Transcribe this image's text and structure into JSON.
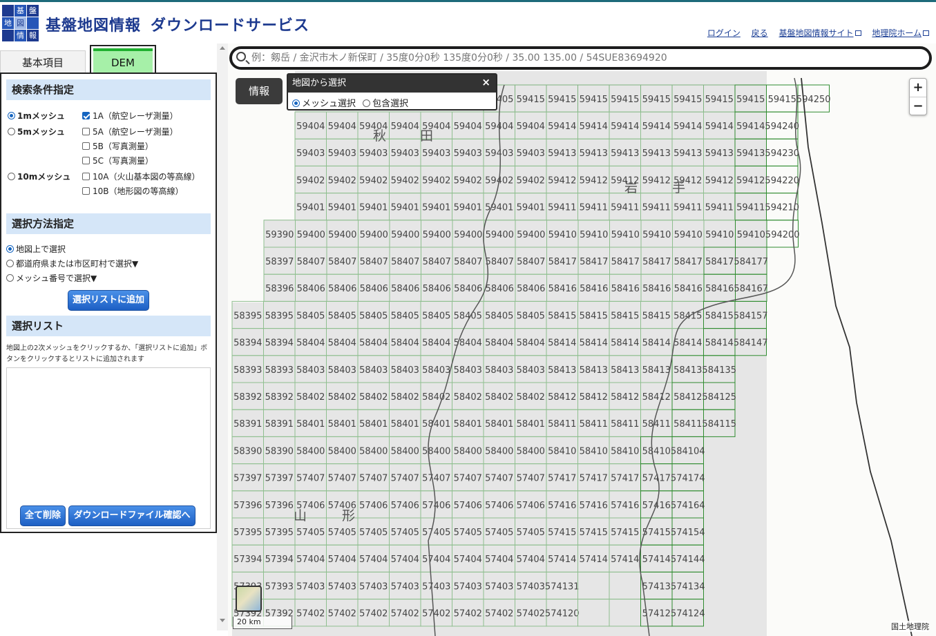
{
  "header": {
    "logo_chars": [
      "基",
      "盤",
      "地",
      "図",
      "情",
      "報"
    ],
    "title": "基盤地図情報",
    "subtitle": "ダウンロードサービス",
    "links": [
      "ログイン",
      "戻る",
      "基盤地図情報サイト",
      "地理院ホーム"
    ]
  },
  "tabs": {
    "basic": "基本項目",
    "dem": "DEM"
  },
  "search_conditions": {
    "heading": "検索条件指定",
    "mesh_1m": "1mメッシュ",
    "mesh_5m": "5mメッシュ",
    "mesh_10m": "10mメッシュ",
    "opt_1a": "1A（航空レーザ測量）",
    "opt_5a": "5A（航空レーザ測量）",
    "opt_5b": "5B（写真測量）",
    "opt_5c": "5C（写真測量）",
    "opt_10a": "10A（火山基本図の等高線）",
    "opt_10b": "10B（地形図の等高線）"
  },
  "selection_method": {
    "heading": "選択方法指定",
    "on_map": "地図上で選択",
    "by_pref": "都道府県または市区町村で選択▼",
    "by_mesh": "メッシュ番号で選択▼",
    "add_button": "選択リストに追加"
  },
  "selection_list": {
    "heading": "選択リスト",
    "hint": "地図上の2次メッシュをクリックするか、「選択リストに追加」ボタンをクリックするとリストに追加されます",
    "delete_all": "全て削除",
    "confirm": "ダウンロードファイル確認へ"
  },
  "map": {
    "search_placeholder": "例：剱岳 / 金沢市木ノ新保町 / 35度0分0秒 135度0分0秒 / 35.00 135.00 / 54SUE83694920",
    "info_button": "情報",
    "popup_title": "地図から選択",
    "popup_close": "×",
    "mesh_select": "メッシュ選択",
    "contain_select": "包含選択",
    "zoom_in": "+",
    "zoom_out": "−",
    "scale": "20 km",
    "attribution": "国土地理院",
    "place_labels": [
      "秋",
      "田",
      "岩",
      "手",
      "山",
      "形"
    ],
    "rows": [
      [
        "59404",
        "59404",
        "59404",
        "59404",
        "59404",
        "59404",
        "59404",
        "59404",
        "59414",
        "59414",
        "59414",
        "59414",
        "59414",
        "59414",
        "59414",
        "594240"
      ],
      [
        "59403",
        "59403",
        "59403",
        "59403",
        "59403",
        "59403",
        "59403",
        "59403",
        "59413",
        "59413",
        "59413",
        "59413",
        "59413",
        "59413",
        "59413",
        "594230"
      ],
      [
        "59402",
        "59402",
        "59402",
        "59402",
        "59402",
        "59402",
        "59402",
        "59402",
        "59412",
        "59412",
        "59412",
        "59412",
        "59412",
        "59412",
        "59412",
        "594220"
      ],
      [
        "59401",
        "59401",
        "59401",
        "59401",
        "59401",
        "59401",
        "59401",
        "59401",
        "59411",
        "59411",
        "59411",
        "59411",
        "59411",
        "59411",
        "59411",
        "594210"
      ],
      [
        "59390",
        "59400",
        "59400",
        "59400",
        "59400",
        "59400",
        "59400",
        "59400",
        "59400",
        "59410",
        "59410",
        "59410",
        "59410",
        "59410",
        "59410",
        "59410",
        "594200"
      ],
      [
        "58397",
        "58407",
        "58407",
        "58407",
        "58407",
        "58407",
        "58407",
        "58407",
        "58407",
        "58417",
        "58417",
        "58417",
        "58417",
        "58417",
        "58417",
        "584177"
      ],
      [
        "58396",
        "58406",
        "58406",
        "58406",
        "58406",
        "58406",
        "58406",
        "58406",
        "58406",
        "58416",
        "58416",
        "58416",
        "58416",
        "58416",
        "58416",
        "584167"
      ],
      [
        "58395",
        "58395",
        "58405",
        "58405",
        "58405",
        "58405",
        "58405",
        "58405",
        "58405",
        "58405",
        "58415",
        "58415",
        "58415",
        "58415",
        "58415",
        "58415",
        "584157"
      ],
      [
        "58394",
        "58394",
        "58404",
        "58404",
        "58404",
        "58404",
        "58404",
        "58404",
        "58404",
        "58404",
        "58414",
        "58414",
        "58414",
        "58414",
        "58414",
        "58414",
        "584147"
      ],
      [
        "58393",
        "58393",
        "58403",
        "58403",
        "58403",
        "58403",
        "58403",
        "58403",
        "58403",
        "58403",
        "58413",
        "58413",
        "58413",
        "58413",
        "58413",
        "584135"
      ],
      [
        "58392",
        "58392",
        "58402",
        "58402",
        "58402",
        "58402",
        "58402",
        "58402",
        "58402",
        "58402",
        "58412",
        "58412",
        "58412",
        "58412",
        "58412",
        "584125"
      ],
      [
        "58391",
        "58391",
        "58401",
        "58401",
        "58401",
        "58401",
        "58401",
        "58401",
        "58401",
        "58401",
        "58411",
        "58411",
        "58411",
        "58411",
        "58411",
        "584115"
      ],
      [
        "58390",
        "58390",
        "58400",
        "58400",
        "58400",
        "58400",
        "58400",
        "58400",
        "58400",
        "58400",
        "58410",
        "58410",
        "58410",
        "58410",
        "584104"
      ],
      [
        "57397",
        "57397",
        "57407",
        "57407",
        "57407",
        "57407",
        "57407",
        "57407",
        "57407",
        "57407",
        "57417",
        "57417",
        "57417",
        "57417",
        "574174"
      ],
      [
        "57396",
        "57396",
        "57406",
        "57406",
        "57406",
        "57406",
        "57406",
        "57406",
        "57406",
        "57406",
        "57416",
        "57416",
        "57416",
        "57416",
        "574164"
      ],
      [
        "57395",
        "57395",
        "57405",
        "57405",
        "57405",
        "57405",
        "57405",
        "57405",
        "57405",
        "57405",
        "57415",
        "57415",
        "57415",
        "57415",
        "574154"
      ],
      [
        "57394",
        "57394",
        "57404",
        "57404",
        "57404",
        "57404",
        "57404",
        "57404",
        "57404",
        "57404",
        "57414",
        "57414",
        "57414",
        "57414",
        "574144"
      ],
      [
        "57393",
        "57393",
        "57403",
        "57403",
        "57403",
        "57403",
        "57403",
        "57403",
        "57403",
        "57403",
        "574131",
        "",
        "",
        "57413",
        "574134"
      ],
      [
        "57392",
        "57392",
        "57402",
        "57402",
        "57402",
        "57402",
        "57402",
        "57402",
        "57402",
        "57402",
        "574120",
        "",
        "",
        "57412",
        "574124"
      ]
    ],
    "top_row": [
      "59405",
      "59415",
      "59415",
      "59415",
      "59415",
      "59415",
      "59415",
      "59415",
      "59415",
      "59415",
      "594250"
    ]
  }
}
